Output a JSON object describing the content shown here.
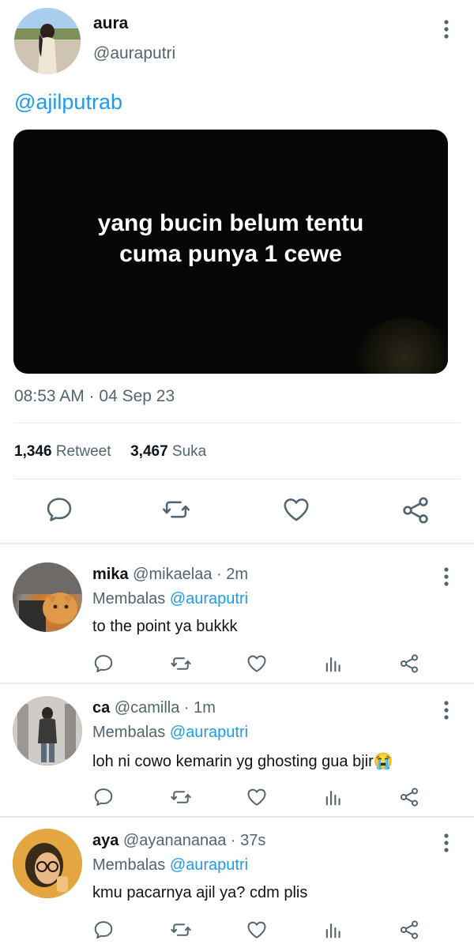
{
  "main_tweet": {
    "author_name": "aura",
    "author_handle": "@auraputri",
    "mention": "@ajilputrab",
    "media_caption_line1": "yang bucin belum tentu",
    "media_caption_line2": "cuma punya 1 cewe",
    "timestamp": "08:53 AM · 04 Sep 23",
    "retweet_count": "1,346",
    "retweet_label": "Retweet",
    "like_count": "3,467",
    "like_label": "Suka",
    "actions": [
      "reply-icon",
      "retweet-icon",
      "heart-icon",
      "share-icon"
    ]
  },
  "replies": [
    {
      "name": "mika",
      "meta": "@mikaelaa · 2m",
      "replying_prefix": "Membalas",
      "replying_to": "@auraputri",
      "text": "to the point ya bukkk"
    },
    {
      "name": "ca",
      "meta": "@camilla · 1m",
      "replying_prefix": "Membalas",
      "replying_to": "@auraputri",
      "text": "loh ni cowo kemarin yg ghosting gua bjir😭"
    },
    {
      "name": "aya",
      "meta": "@ayanananaa · 37s",
      "replying_prefix": "Membalas",
      "replying_to": "@auraputri",
      "text": "kmu pacarnya ajil ya? cdm plis"
    }
  ],
  "reply_actions": [
    "reply-icon",
    "retweet-icon",
    "heart-icon",
    "analytics-icon",
    "share-icon"
  ],
  "colors": {
    "accent": "#1d9bf0",
    "secondary_text": "#536471",
    "icon": "#536471",
    "divider": "#e6ecf0"
  }
}
